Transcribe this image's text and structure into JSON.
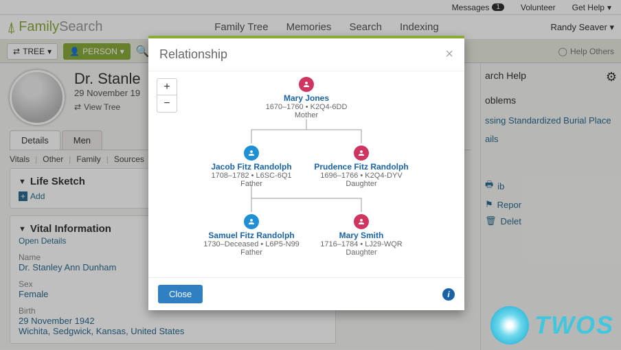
{
  "topbar": {
    "messages_label": "Messages",
    "messages_count": "1",
    "volunteer": "Volunteer",
    "get_help": "Get Help"
  },
  "logo": {
    "family": "Family",
    "search": "Search"
  },
  "main_nav": {
    "tree": "Family Tree",
    "memories": "Memories",
    "search": "Search",
    "indexing": "Indexing"
  },
  "user_menu": "Randy Seaver",
  "toolbar": {
    "tree": "TREE",
    "person": "PERSON",
    "help_others": "Help Others"
  },
  "person": {
    "name_full": "Dr. Stanley Ann Dunham",
    "name_truncated": "Dr. Stanle",
    "dates_truncated": "29 November 19",
    "view_tree": "View Tree"
  },
  "tabs": {
    "details": "Details",
    "memories_truncated": "Men"
  },
  "subnav": {
    "vitals": "Vitals",
    "other": "Other",
    "family": "Family",
    "sources": "Sources"
  },
  "life_sketch": {
    "title": "Life Sketch",
    "add": "Add"
  },
  "vital_info": {
    "title": "Vital Information",
    "open_details": "Open Details",
    "name_lbl": "Name",
    "name_val": "Dr. Stanley Ann Dunham",
    "sex_lbl": "Sex",
    "sex_val": "Female",
    "birth_lbl": "Birth",
    "birth_date": "29 November 1942",
    "birth_place": "Wichita, Sedgwick, Kansas, United States"
  },
  "right": {
    "help_title_trunc": "arch Help",
    "problems_trunc": "oblems",
    "missing_trunc": "ssing Standardized Burial Place",
    "details_trunc": "ails",
    "options_report_trunc": "Repor",
    "options_delete_trunc": "Delet"
  },
  "modal": {
    "title": "Relationship",
    "close_btn": "Close",
    "zoom_plus": "+",
    "zoom_minus": "−",
    "nodes": [
      {
        "name": "Mary Jones",
        "meta": "1670–1760 • K2Q4-6DD",
        "role": "Mother"
      },
      {
        "name": "Jacob Fitz Randolph",
        "meta": "1708–1782 • L6SC-6Q1",
        "role": "Father"
      },
      {
        "name": "Prudence Fitz Randolph",
        "meta": "1696–1766 • K2Q4-DYV",
        "role": "Daughter"
      },
      {
        "name": "Samuel Fitz Randolph",
        "meta": "1730–Deceased • L6P5-N99",
        "role": "Father"
      },
      {
        "name": "Mary Smith",
        "meta": "1716–1784 • LJ29-WQR",
        "role": "Daughter"
      }
    ]
  },
  "twos": "TWOS"
}
